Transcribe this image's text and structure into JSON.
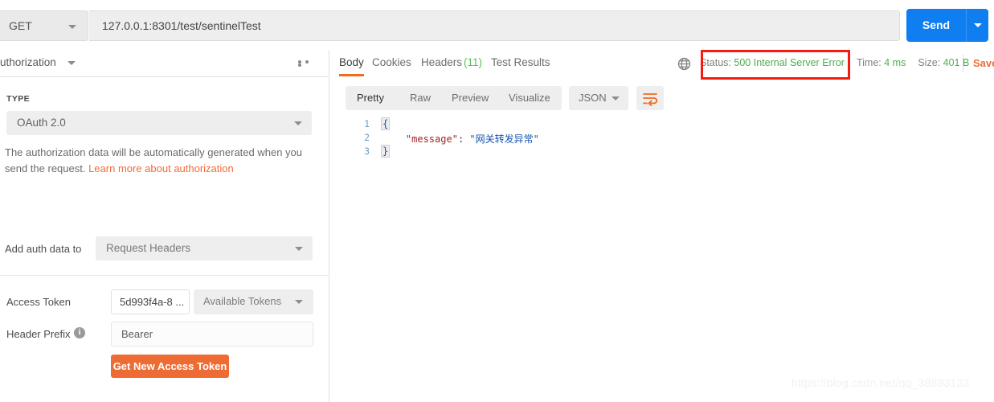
{
  "request": {
    "method": "GET",
    "url": "127.0.0.1:8301/test/sentinelTest",
    "send_label": "Send"
  },
  "left_panel": {
    "tab_label": "Authorization",
    "more_icon": "ellipsis-icon",
    "type_label": "TYPE",
    "type_value": "OAuth 2.0",
    "help_text": "The authorization data will be automatically generated when you send the request. ",
    "help_link": "Learn more about authorization",
    "add_auth_label": "Add auth data to",
    "add_auth_value": "Request Headers",
    "access_token_label": "Access Token",
    "access_token_value": "5d993f4a-8 ...",
    "available_tokens_value": "Available Tokens",
    "header_prefix_label": "Header Prefix",
    "header_prefix_info": "i",
    "header_prefix_value": "Bearer",
    "get_token_button": "Get New Access Token"
  },
  "response": {
    "tabs": [
      {
        "label": "Body",
        "active": true
      },
      {
        "label": "Cookies",
        "active": false
      },
      {
        "label": "Headers",
        "count": "(11)",
        "active": false
      },
      {
        "label": "Test Results",
        "active": false
      }
    ],
    "globe_icon": "globe-icon",
    "status_label": "Status:",
    "status_value": "500 Internal Server Error",
    "time_label": "Time:",
    "time_value": "4 ms",
    "size_label": "Size:",
    "size_value": "401 B",
    "save_label": "Save",
    "format_tabs": [
      {
        "label": "Pretty",
        "active": true
      },
      {
        "label": "Raw",
        "active": false
      },
      {
        "label": "Preview",
        "active": false
      },
      {
        "label": "Visualize",
        "active": false
      }
    ],
    "language": "JSON",
    "wrap_icon": "wrap-text-icon",
    "code_lines": [
      {
        "no": "1",
        "kind": "brace",
        "text": "{"
      },
      {
        "no": "2",
        "kind": "pair",
        "key": "\"message\"",
        "punct": ": ",
        "value": "\"网关转发异常\""
      },
      {
        "no": "3",
        "kind": "brace",
        "text": "}"
      }
    ]
  },
  "watermark": "https://blog.csdn.net/qq_38893133",
  "colors": {
    "accent_orange": "#f26b21",
    "send_blue": "#0e7ef0",
    "status_green": "#4dae4d",
    "annotation_red": "#f61a0f",
    "json_key": "#a4262c",
    "json_string": "#1452b0"
  }
}
